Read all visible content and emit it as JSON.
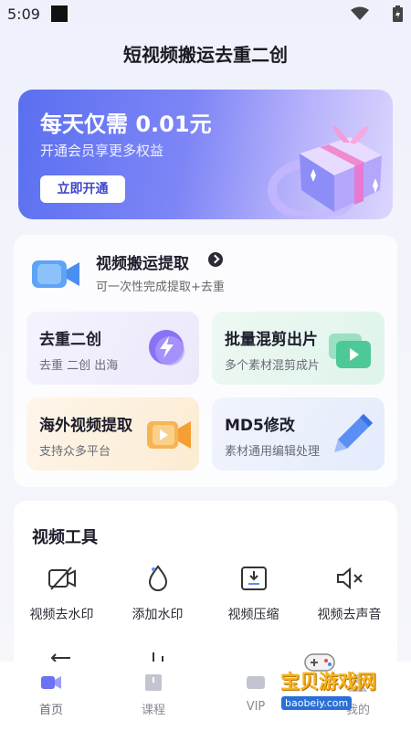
{
  "status_bar": {
    "time": "5:09"
  },
  "header": {
    "title": "短视频搬运去重二创"
  },
  "banner": {
    "title": "每天仅需 0.01元",
    "subtitle": "开通会员享更多权益",
    "button": "立即开通"
  },
  "extract": {
    "title": "视频搬运提取",
    "subtitle": "可一次性完成提取+去重"
  },
  "tiles": [
    {
      "title": "去重二创",
      "subtitle": "去重  二创  出海"
    },
    {
      "title": "批量混剪出片",
      "subtitle": "多个素材混剪成片"
    },
    {
      "title": "海外视频提取",
      "subtitle": "支持众多平台"
    },
    {
      "title": "MD5修改",
      "subtitle": "素材通用编辑处理"
    }
  ],
  "tools": {
    "title": "视频工具",
    "items": [
      {
        "label": "视频去水印",
        "icon": "video-crossed-icon"
      },
      {
        "label": "添加水印",
        "icon": "droplet-icon"
      },
      {
        "label": "视频压缩",
        "icon": "compress-icon"
      },
      {
        "label": "视频去声音",
        "icon": "mute-icon"
      }
    ]
  },
  "nav": {
    "items": [
      {
        "label": "首页",
        "icon": "video-home-icon"
      },
      {
        "label": "课程",
        "icon": "book-icon"
      },
      {
        "label": "VIP",
        "icon": "vip-icon"
      },
      {
        "label": "我的",
        "icon": "user-icon"
      }
    ]
  },
  "watermark": {
    "text": "宝贝游戏网",
    "url": "baobeiy.com"
  },
  "colors": {
    "accent": "#5a6ff0",
    "banner_end": "#dcd6fd"
  }
}
